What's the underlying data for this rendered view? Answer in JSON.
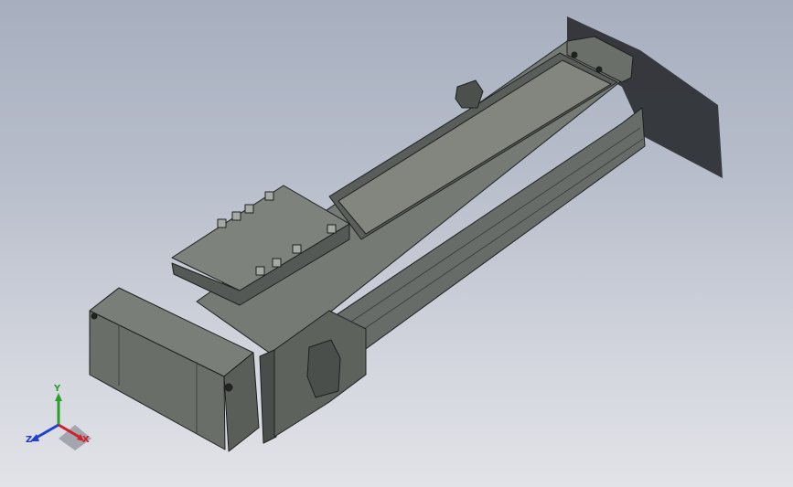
{
  "viewport": {
    "triad": {
      "x_label": "X",
      "y_label": "Y",
      "z_label": "Z",
      "x_color": "#d2202a",
      "y_color": "#2aa02a",
      "z_color": "#2040d0"
    },
    "model": {
      "icon": "linear-actuator-model",
      "body_color": "#5e625e",
      "shadow_color": "#2f3236"
    }
  }
}
